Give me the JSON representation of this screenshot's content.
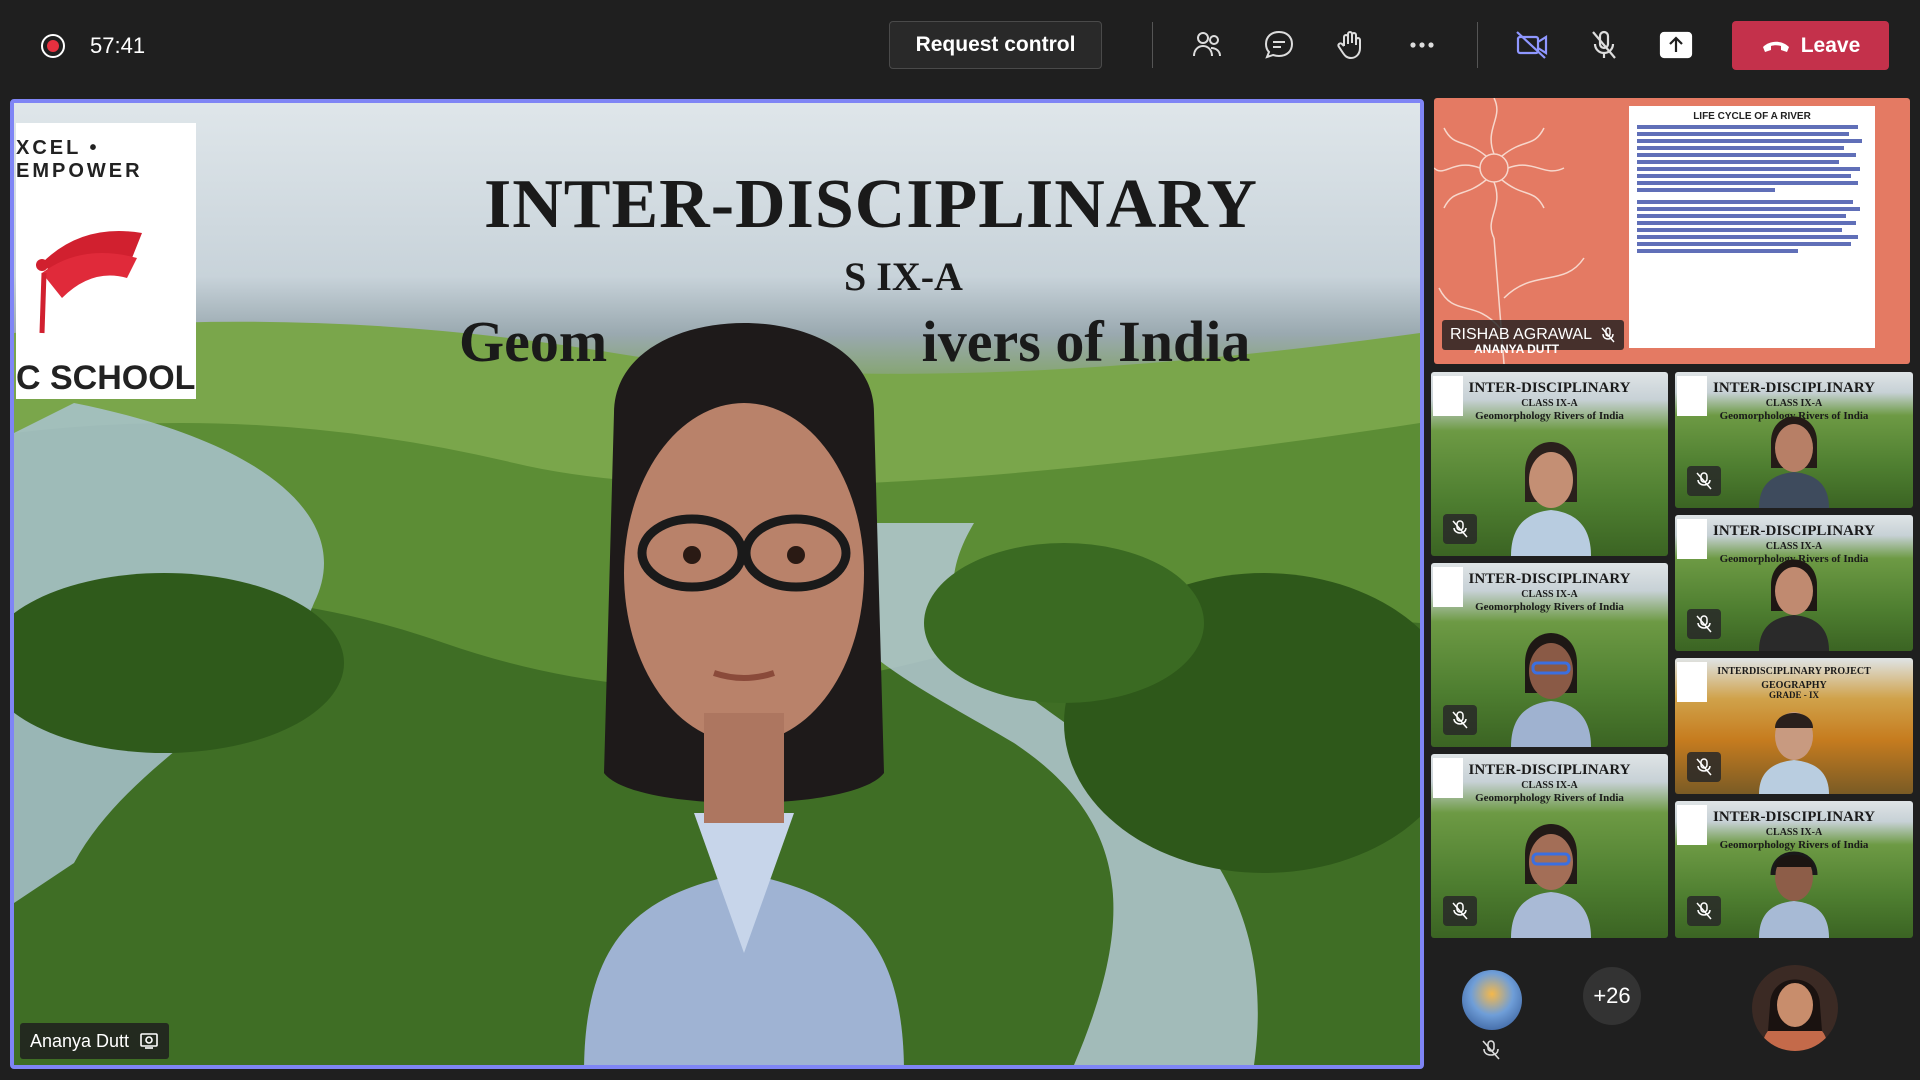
{
  "call": {
    "timer": "57:41",
    "request_control_label": "Request control",
    "leave_label": "Leave"
  },
  "colors": {
    "leave": "#c4314b",
    "active_speaker_border": "#7f85f5",
    "record": "#e6303f"
  },
  "toolbar_icons": [
    "people-icon",
    "chat-icon",
    "raise-hand-icon",
    "more-options-icon",
    "camera-off-icon",
    "mic-off-icon",
    "share-screen-icon",
    "phone-hangup-icon"
  ],
  "stage": {
    "slide_title": "INTER-DISCIPLINARY",
    "slide_subtitle_partial": "S IX-A",
    "slide_topic_left": "Geom",
    "slide_topic_right": "ivers of India",
    "logo_text_top": "XCEL • EMPOWER",
    "logo_text_bottom": "C SCHOOL",
    "participant_name": "Ananya Dutt"
  },
  "shared_screen": {
    "presenter": "RISHAB AGRAWAL",
    "overlay_name": "ANANYA DUTT",
    "doc_title": "LIFE CYCLE OF A RIVER"
  },
  "thumbnails": [
    {
      "title": "INTER-DISCIPLINARY",
      "sub": "CLASS IX-A",
      "topic": "Geomorphology Rivers of India"
    },
    {
      "title": "INTER-DISCIPLINARY",
      "sub": "CLASS IX-A",
      "topic": "Geomorphology Rivers of India"
    },
    {
      "title": "INTER-DISCIPLINARY",
      "sub": "CLASS IX-A",
      "topic": "Geomorphology Rivers of India"
    },
    {
      "title": "INTER-DISCIPLINARY",
      "sub": "CLASS IX-A",
      "topic": "Geomorphology Rivers of India"
    },
    {
      "title": "INTER-DISCIPLINARY",
      "sub": "CLASS IX-A",
      "topic": "Geomorphology Rivers of India"
    },
    {
      "title": "INTERDISCIPLINARY PROJECT",
      "sub": "GEOGRAPHY",
      "topic": "GRADE - IX"
    },
    {
      "title": "INTER-DISCIPLINARY",
      "sub": "CLASS IX-A",
      "topic": "Geomorphology Rivers of India"
    }
  ],
  "overflow": {
    "more_count": "+26"
  }
}
